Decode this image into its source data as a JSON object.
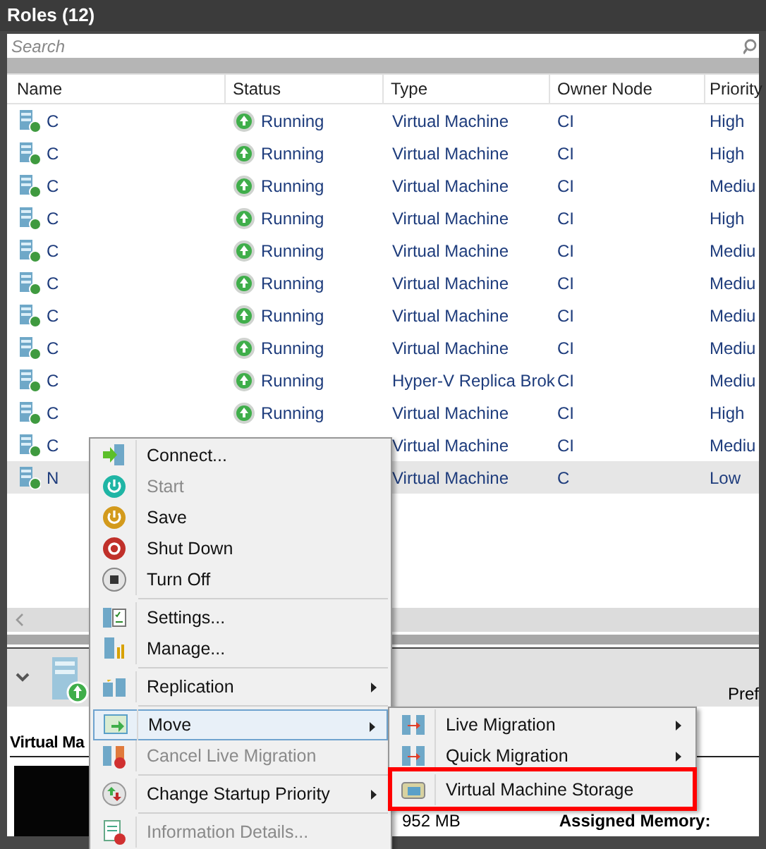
{
  "pane": {
    "title": "Roles (12)"
  },
  "search": {
    "placeholder": "Search"
  },
  "table": {
    "columns": [
      "Name",
      "Status",
      "Type",
      "Owner Node",
      "Priority"
    ],
    "rows": [
      {
        "name": "C",
        "status": "Running",
        "type": "Virtual Machine",
        "owner_node": "CI",
        "priority": "High",
        "selected": false
      },
      {
        "name": "C",
        "status": "Running",
        "type": "Virtual Machine",
        "owner_node": "CI",
        "priority": "High",
        "selected": false
      },
      {
        "name": "C",
        "status": "Running",
        "type": "Virtual Machine",
        "owner_node": "CI",
        "priority": "Mediu",
        "selected": false
      },
      {
        "name": "C",
        "status": "Running",
        "type": "Virtual Machine",
        "owner_node": "CI",
        "priority": "High",
        "selected": false
      },
      {
        "name": "C",
        "status": "Running",
        "type": "Virtual Machine",
        "owner_node": "CI",
        "priority": "Mediu",
        "selected": false
      },
      {
        "name": "C",
        "status": "Running",
        "type": "Virtual Machine",
        "owner_node": "CI",
        "priority": "Mediu",
        "selected": false
      },
      {
        "name": "C",
        "status": "Running",
        "type": "Virtual Machine",
        "owner_node": "CI",
        "priority": "Mediu",
        "selected": false
      },
      {
        "name": "C",
        "status": "Running",
        "type": "Virtual Machine",
        "owner_node": "CI",
        "priority": "Mediu",
        "selected": false
      },
      {
        "name": "C",
        "status": "Running",
        "type": "Hyper-V Replica Brok",
        "owner_node": "CI",
        "priority": "Mediu",
        "selected": false
      },
      {
        "name": "C",
        "status": "Running",
        "type": "Virtual Machine",
        "owner_node": "CI",
        "priority": "High",
        "selected": false
      },
      {
        "name": "C",
        "type": "Virtual Machine",
        "owner_node": "CI",
        "priority": "Mediu",
        "selected": false
      },
      {
        "name": "N",
        "type": "Virtual Machine",
        "owner_node": "C",
        "priority": "Low",
        "selected": true
      }
    ]
  },
  "details": {
    "header_text": "Pref",
    "section_title": "Virtual Ma",
    "memory": "952 MB",
    "memory_label": "Assigned Memory:"
  },
  "context_menu": {
    "items": [
      {
        "kind": "item",
        "label": "Connect...",
        "disabled": false,
        "submenu": false,
        "highlighted": false
      },
      {
        "kind": "item",
        "label": "Start",
        "disabled": true,
        "submenu": false,
        "highlighted": false
      },
      {
        "kind": "item",
        "label": "Save",
        "disabled": false,
        "submenu": false,
        "highlighted": false
      },
      {
        "kind": "item",
        "label": "Shut Down",
        "disabled": false,
        "submenu": false,
        "highlighted": false
      },
      {
        "kind": "item",
        "label": "Turn Off",
        "disabled": false,
        "submenu": false,
        "highlighted": false
      },
      {
        "kind": "separator"
      },
      {
        "kind": "item",
        "label": "Settings...",
        "disabled": false,
        "submenu": false,
        "highlighted": false
      },
      {
        "kind": "item",
        "label": "Manage...",
        "disabled": false,
        "submenu": false,
        "highlighted": false
      },
      {
        "kind": "separator"
      },
      {
        "kind": "item",
        "label": "Replication",
        "disabled": false,
        "submenu": true,
        "highlighted": false
      },
      {
        "kind": "separator"
      },
      {
        "kind": "item",
        "label": "Move",
        "disabled": false,
        "submenu": true,
        "highlighted": true
      },
      {
        "kind": "item",
        "label": "Cancel Live Migration",
        "disabled": true,
        "submenu": false,
        "highlighted": false
      },
      {
        "kind": "separator"
      },
      {
        "kind": "item",
        "label": "Change Startup Priority",
        "disabled": false,
        "submenu": true,
        "highlighted": false
      },
      {
        "kind": "separator"
      },
      {
        "kind": "item",
        "label": "Information Details...",
        "disabled": true,
        "submenu": false,
        "highlighted": false
      }
    ]
  },
  "submenu": {
    "items": [
      {
        "label": "Live Migration",
        "submenu": true,
        "annotated": false
      },
      {
        "label": "Quick Migration",
        "submenu": true,
        "annotated": false
      },
      {
        "label": "Virtual Machine Storage",
        "submenu": false,
        "annotated": true
      }
    ]
  }
}
